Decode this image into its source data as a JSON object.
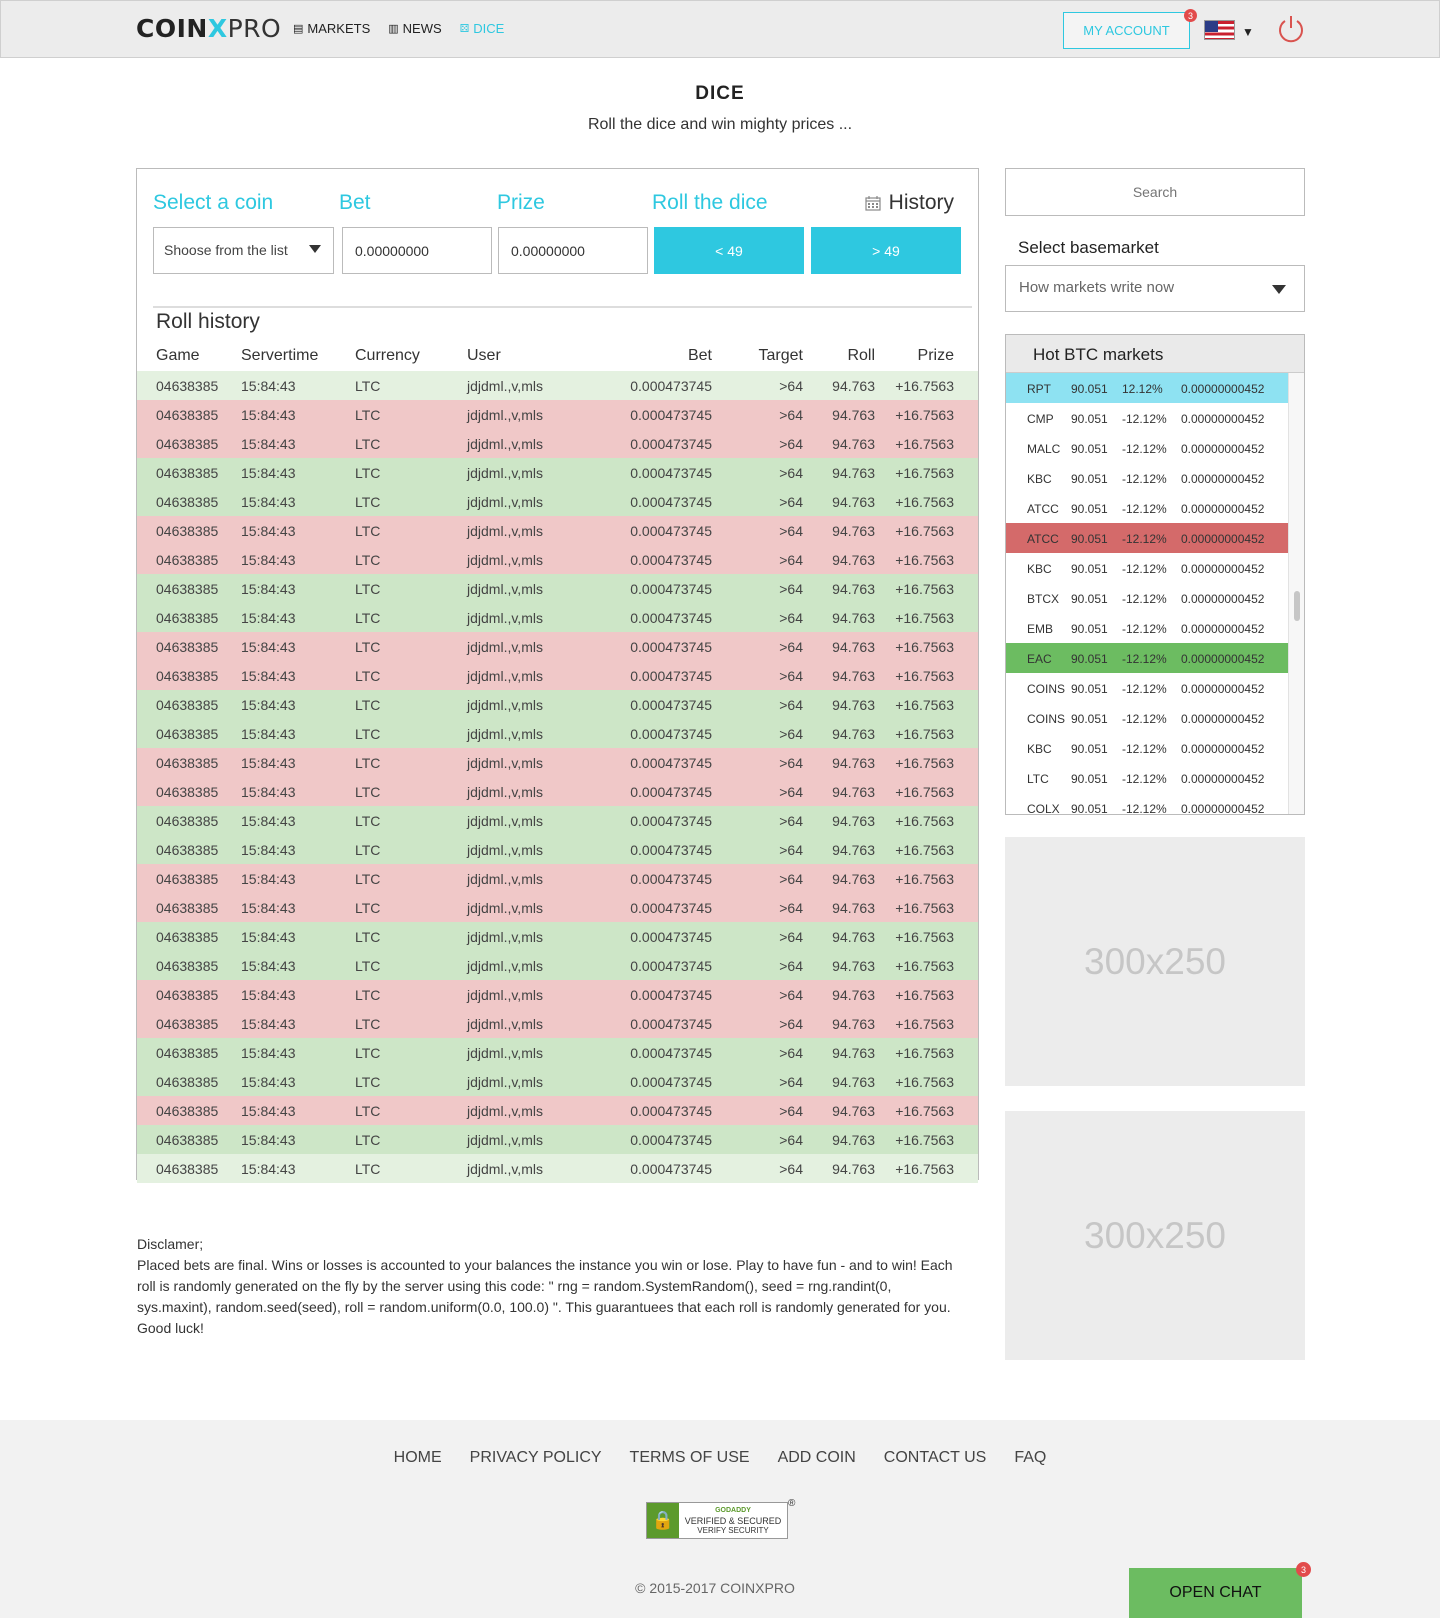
{
  "header": {
    "logo": {
      "coin": "COIN",
      "x": "X",
      "pro": "PRO"
    },
    "nav": [
      {
        "label": "MARKETS",
        "icon": "store-icon"
      },
      {
        "label": "NEWS",
        "icon": "newspaper-icon"
      },
      {
        "label": "DICE",
        "icon": "dice-icon"
      }
    ],
    "my_account_label": "MY ACCOUNT",
    "account_badge": "3",
    "language_flag": "us-flag-icon"
  },
  "page": {
    "title": "DICE",
    "subtitle": "Roll the dice and win mighty prices ..."
  },
  "controls": {
    "select_coin_label": "Select a coin",
    "bet_label": "Bet",
    "prize_label": "Prize",
    "roll_label": "Roll the dice",
    "history_label": "History",
    "coin_placeholder": "Shoose from the list",
    "bet_value": "0.00000000",
    "prize_value": "0.00000000",
    "under_button": "< 49",
    "over_button": "> 49"
  },
  "roll_history": {
    "title": "Roll history",
    "columns": [
      "Game",
      "Servertime",
      "Currency",
      "User",
      "Bet",
      "Target",
      "Roll",
      "Prize"
    ],
    "rows": [
      {
        "result": "win-light",
        "game": "04638385",
        "time": "15:84:43",
        "currency": "LTC",
        "user": "jdjdml.,v,mls",
        "bet": "0.000473745",
        "target": ">64",
        "roll": "94.763",
        "prize": "+16.7563"
      },
      {
        "result": "lose",
        "game": "04638385",
        "time": "15:84:43",
        "currency": "LTC",
        "user": "jdjdml.,v,mls",
        "bet": "0.000473745",
        "target": ">64",
        "roll": "94.763",
        "prize": "+16.7563"
      },
      {
        "result": "lose",
        "game": "04638385",
        "time": "15:84:43",
        "currency": "LTC",
        "user": "jdjdml.,v,mls",
        "bet": "0.000473745",
        "target": ">64",
        "roll": "94.763",
        "prize": "+16.7563"
      },
      {
        "result": "win",
        "game": "04638385",
        "time": "15:84:43",
        "currency": "LTC",
        "user": "jdjdml.,v,mls",
        "bet": "0.000473745",
        "target": ">64",
        "roll": "94.763",
        "prize": "+16.7563"
      },
      {
        "result": "win",
        "game": "04638385",
        "time": "15:84:43",
        "currency": "LTC",
        "user": "jdjdml.,v,mls",
        "bet": "0.000473745",
        "target": ">64",
        "roll": "94.763",
        "prize": "+16.7563"
      },
      {
        "result": "lose",
        "game": "04638385",
        "time": "15:84:43",
        "currency": "LTC",
        "user": "jdjdml.,v,mls",
        "bet": "0.000473745",
        "target": ">64",
        "roll": "94.763",
        "prize": "+16.7563"
      },
      {
        "result": "lose",
        "game": "04638385",
        "time": "15:84:43",
        "currency": "LTC",
        "user": "jdjdml.,v,mls",
        "bet": "0.000473745",
        "target": ">64",
        "roll": "94.763",
        "prize": "+16.7563"
      },
      {
        "result": "win",
        "game": "04638385",
        "time": "15:84:43",
        "currency": "LTC",
        "user": "jdjdml.,v,mls",
        "bet": "0.000473745",
        "target": ">64",
        "roll": "94.763",
        "prize": "+16.7563"
      },
      {
        "result": "win",
        "game": "04638385",
        "time": "15:84:43",
        "currency": "LTC",
        "user": "jdjdml.,v,mls",
        "bet": "0.000473745",
        "target": ">64",
        "roll": "94.763",
        "prize": "+16.7563"
      },
      {
        "result": "lose",
        "game": "04638385",
        "time": "15:84:43",
        "currency": "LTC",
        "user": "jdjdml.,v,mls",
        "bet": "0.000473745",
        "target": ">64",
        "roll": "94.763",
        "prize": "+16.7563"
      },
      {
        "result": "lose",
        "game": "04638385",
        "time": "15:84:43",
        "currency": "LTC",
        "user": "jdjdml.,v,mls",
        "bet": "0.000473745",
        "target": ">64",
        "roll": "94.763",
        "prize": "+16.7563"
      },
      {
        "result": "win",
        "game": "04638385",
        "time": "15:84:43",
        "currency": "LTC",
        "user": "jdjdml.,v,mls",
        "bet": "0.000473745",
        "target": ">64",
        "roll": "94.763",
        "prize": "+16.7563"
      },
      {
        "result": "win",
        "game": "04638385",
        "time": "15:84:43",
        "currency": "LTC",
        "user": "jdjdml.,v,mls",
        "bet": "0.000473745",
        "target": ">64",
        "roll": "94.763",
        "prize": "+16.7563"
      },
      {
        "result": "lose",
        "game": "04638385",
        "time": "15:84:43",
        "currency": "LTC",
        "user": "jdjdml.,v,mls",
        "bet": "0.000473745",
        "target": ">64",
        "roll": "94.763",
        "prize": "+16.7563"
      },
      {
        "result": "lose",
        "game": "04638385",
        "time": "15:84:43",
        "currency": "LTC",
        "user": "jdjdml.,v,mls",
        "bet": "0.000473745",
        "target": ">64",
        "roll": "94.763",
        "prize": "+16.7563"
      },
      {
        "result": "win",
        "game": "04638385",
        "time": "15:84:43",
        "currency": "LTC",
        "user": "jdjdml.,v,mls",
        "bet": "0.000473745",
        "target": ">64",
        "roll": "94.763",
        "prize": "+16.7563"
      },
      {
        "result": "win",
        "game": "04638385",
        "time": "15:84:43",
        "currency": "LTC",
        "user": "jdjdml.,v,mls",
        "bet": "0.000473745",
        "target": ">64",
        "roll": "94.763",
        "prize": "+16.7563"
      },
      {
        "result": "lose",
        "game": "04638385",
        "time": "15:84:43",
        "currency": "LTC",
        "user": "jdjdml.,v,mls",
        "bet": "0.000473745",
        "target": ">64",
        "roll": "94.763",
        "prize": "+16.7563"
      },
      {
        "result": "lose",
        "game": "04638385",
        "time": "15:84:43",
        "currency": "LTC",
        "user": "jdjdml.,v,mls",
        "bet": "0.000473745",
        "target": ">64",
        "roll": "94.763",
        "prize": "+16.7563"
      },
      {
        "result": "win",
        "game": "04638385",
        "time": "15:84:43",
        "currency": "LTC",
        "user": "jdjdml.,v,mls",
        "bet": "0.000473745",
        "target": ">64",
        "roll": "94.763",
        "prize": "+16.7563"
      },
      {
        "result": "win",
        "game": "04638385",
        "time": "15:84:43",
        "currency": "LTC",
        "user": "jdjdml.,v,mls",
        "bet": "0.000473745",
        "target": ">64",
        "roll": "94.763",
        "prize": "+16.7563"
      },
      {
        "result": "lose",
        "game": "04638385",
        "time": "15:84:43",
        "currency": "LTC",
        "user": "jdjdml.,v,mls",
        "bet": "0.000473745",
        "target": ">64",
        "roll": "94.763",
        "prize": "+16.7563"
      },
      {
        "result": "lose",
        "game": "04638385",
        "time": "15:84:43",
        "currency": "LTC",
        "user": "jdjdml.,v,mls",
        "bet": "0.000473745",
        "target": ">64",
        "roll": "94.763",
        "prize": "+16.7563"
      },
      {
        "result": "win",
        "game": "04638385",
        "time": "15:84:43",
        "currency": "LTC",
        "user": "jdjdml.,v,mls",
        "bet": "0.000473745",
        "target": ">64",
        "roll": "94.763",
        "prize": "+16.7563"
      },
      {
        "result": "win",
        "game": "04638385",
        "time": "15:84:43",
        "currency": "LTC",
        "user": "jdjdml.,v,mls",
        "bet": "0.000473745",
        "target": ">64",
        "roll": "94.763",
        "prize": "+16.7563"
      },
      {
        "result": "lose",
        "game": "04638385",
        "time": "15:84:43",
        "currency": "LTC",
        "user": "jdjdml.,v,mls",
        "bet": "0.000473745",
        "target": ">64",
        "roll": "94.763",
        "prize": "+16.7563"
      },
      {
        "result": "win",
        "game": "04638385",
        "time": "15:84:43",
        "currency": "LTC",
        "user": "jdjdml.,v,mls",
        "bet": "0.000473745",
        "target": ">64",
        "roll": "94.763",
        "prize": "+16.7563"
      },
      {
        "result": "win-light",
        "game": "04638385",
        "time": "15:84:43",
        "currency": "LTC",
        "user": "jdjdml.,v,mls",
        "bet": "0.000473745",
        "target": ">64",
        "roll": "94.763",
        "prize": "+16.7563"
      }
    ]
  },
  "disclaimer": {
    "heading": "Disclamer;",
    "text": "Placed bets are final. Wins or losses is accounted to your balances the instance you win or lose. Play to have fun - and to win! Each roll is randomly generated on the fly by the server using this code: \" rng = random.SystemRandom(), seed = rng.randint(0, sys.maxint), random.seed(seed), roll = random.uniform(0.0, 100.0) \". This guarantuees that each roll is randomly generated for you. Good luck!"
  },
  "sidebar": {
    "search_placeholder": "Search",
    "basemarket_label": "Select basemarket",
    "basemarket_value": "How markets write now",
    "hot_title": "Hot BTC markets",
    "hot_markets": [
      {
        "state": "sel",
        "symbol": "RPT",
        "price": "90.051",
        "change": "12.12%",
        "volume": "0.00000000452"
      },
      {
        "state": "",
        "symbol": "CMP",
        "price": "90.051",
        "change": "-12.12%",
        "volume": "0.00000000452"
      },
      {
        "state": "",
        "symbol": "MALC",
        "price": "90.051",
        "change": "-12.12%",
        "volume": "0.00000000452"
      },
      {
        "state": "",
        "symbol": "KBC",
        "price": "90.051",
        "change": "-12.12%",
        "volume": "0.00000000452"
      },
      {
        "state": "",
        "symbol": "ATCC",
        "price": "90.051",
        "change": "-12.12%",
        "volume": "0.00000000452"
      },
      {
        "state": "down",
        "symbol": "ATCC",
        "price": "90.051",
        "change": "-12.12%",
        "volume": "0.00000000452"
      },
      {
        "state": "",
        "symbol": "KBC",
        "price": "90.051",
        "change": "-12.12%",
        "volume": "0.00000000452"
      },
      {
        "state": "",
        "symbol": "BTCX",
        "price": "90.051",
        "change": "-12.12%",
        "volume": "0.00000000452"
      },
      {
        "state": "",
        "symbol": "EMB",
        "price": "90.051",
        "change": "-12.12%",
        "volume": "0.00000000452"
      },
      {
        "state": "up",
        "symbol": "EAC",
        "price": "90.051",
        "change": "-12.12%",
        "volume": "0.00000000452"
      },
      {
        "state": "",
        "symbol": "COINS",
        "price": "90.051",
        "change": "-12.12%",
        "volume": "0.00000000452"
      },
      {
        "state": "",
        "symbol": "COINS",
        "price": "90.051",
        "change": "-12.12%",
        "volume": "0.00000000452"
      },
      {
        "state": "",
        "symbol": "KBC",
        "price": "90.051",
        "change": "-12.12%",
        "volume": "0.00000000452"
      },
      {
        "state": "",
        "symbol": "LTC",
        "price": "90.051",
        "change": "-12.12%",
        "volume": "0.00000000452"
      },
      {
        "state": "",
        "symbol": "COLX",
        "price": "90.051",
        "change": "-12.12%",
        "volume": "0.00000000452"
      }
    ],
    "ad_1": "300x250",
    "ad_2": "300x250"
  },
  "footer": {
    "links": [
      "HOME",
      "PRIVACY POLICY",
      "TERMS OF USE",
      "ADD COIN",
      "CONTACT US",
      "FAQ"
    ],
    "seal": {
      "brand": "GODADDY",
      "line1": "VERIFIED & SECURED",
      "line2": "VERIFY SECURITY"
    },
    "copyright": "© 2015-2017 COINXPRO"
  },
  "chat": {
    "label": "OPEN CHAT",
    "badge": "3"
  },
  "colors": {
    "accent": "#2ec8e0",
    "win": "#cde6c7",
    "lose": "#f0c8c8",
    "hot_up": "#6cbc61",
    "hot_down": "#d46a6a",
    "hot_selected": "#8ee2f2"
  }
}
